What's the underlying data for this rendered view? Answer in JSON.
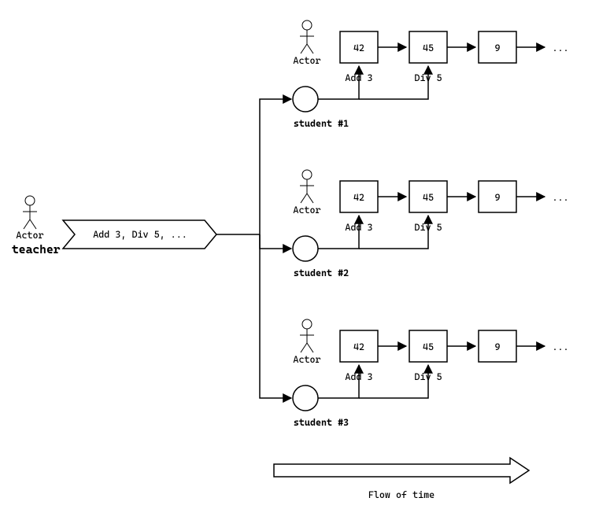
{
  "teacher": {
    "actor_label": "Actor",
    "name": "teacher",
    "message": "Add 3, Div 5, ..."
  },
  "students": [
    {
      "actor_label": "Actor",
      "label": "student #1",
      "boxes": [
        "42",
        "45",
        "9"
      ],
      "ops": [
        "Add 3",
        "Div 5"
      ],
      "ellipsis": "..."
    },
    {
      "actor_label": "Actor",
      "label": "student #2",
      "boxes": [
        "42",
        "45",
        "9"
      ],
      "ops": [
        "Add 3",
        "Div 5"
      ],
      "ellipsis": "..."
    },
    {
      "actor_label": "Actor",
      "label": "student #3",
      "boxes": [
        "42",
        "45",
        "9"
      ],
      "ops": [
        "Add 3",
        "Div 5"
      ],
      "ellipsis": "..."
    }
  ],
  "flow_label": "Flow of time"
}
